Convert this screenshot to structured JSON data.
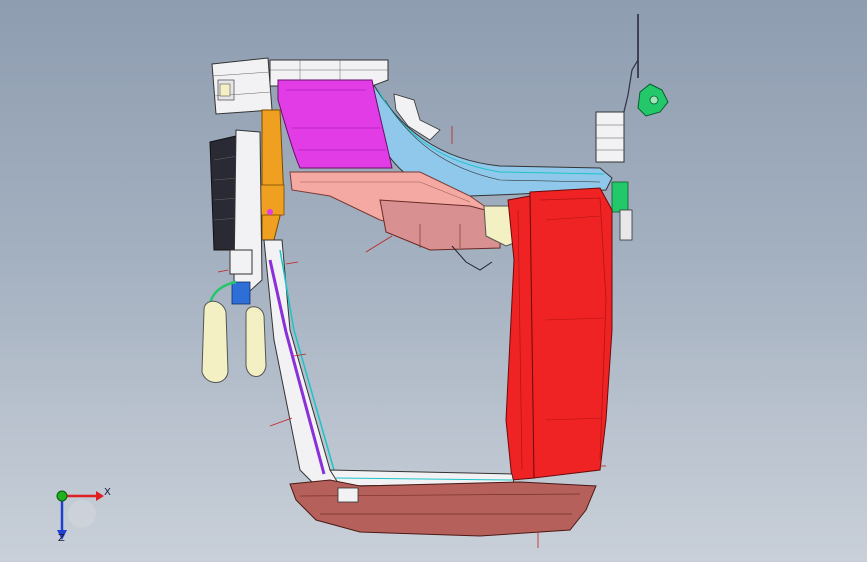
{
  "viewport": {
    "background_top": "#8e9db0",
    "background_bottom": "#c9d0d9"
  },
  "model": {
    "colors": {
      "magenta_panel": "#e23ce6",
      "red_panel": "#ef2323",
      "red_dark": "#b01414",
      "salmon_panel": "#f4a9a3",
      "pink_panel": "#d99090",
      "blue_rail": "#8fc8ea",
      "cyan_edge": "#1cc4c8",
      "purple_rail": "#8a2fd9",
      "orange_bracket": "#f0a020",
      "cream_part": "#f3f0c4",
      "white_part": "#f2f2f4",
      "green_part": "#22c86a",
      "sill_brown": "#b5605a",
      "wire_dark": "#222233"
    }
  },
  "triad": {
    "x_label": "X",
    "z_label": "Z",
    "x_color": "#e02020",
    "y_color": "#20b020",
    "z_color": "#2040d0",
    "icon": "coordinate-triad-icon"
  }
}
